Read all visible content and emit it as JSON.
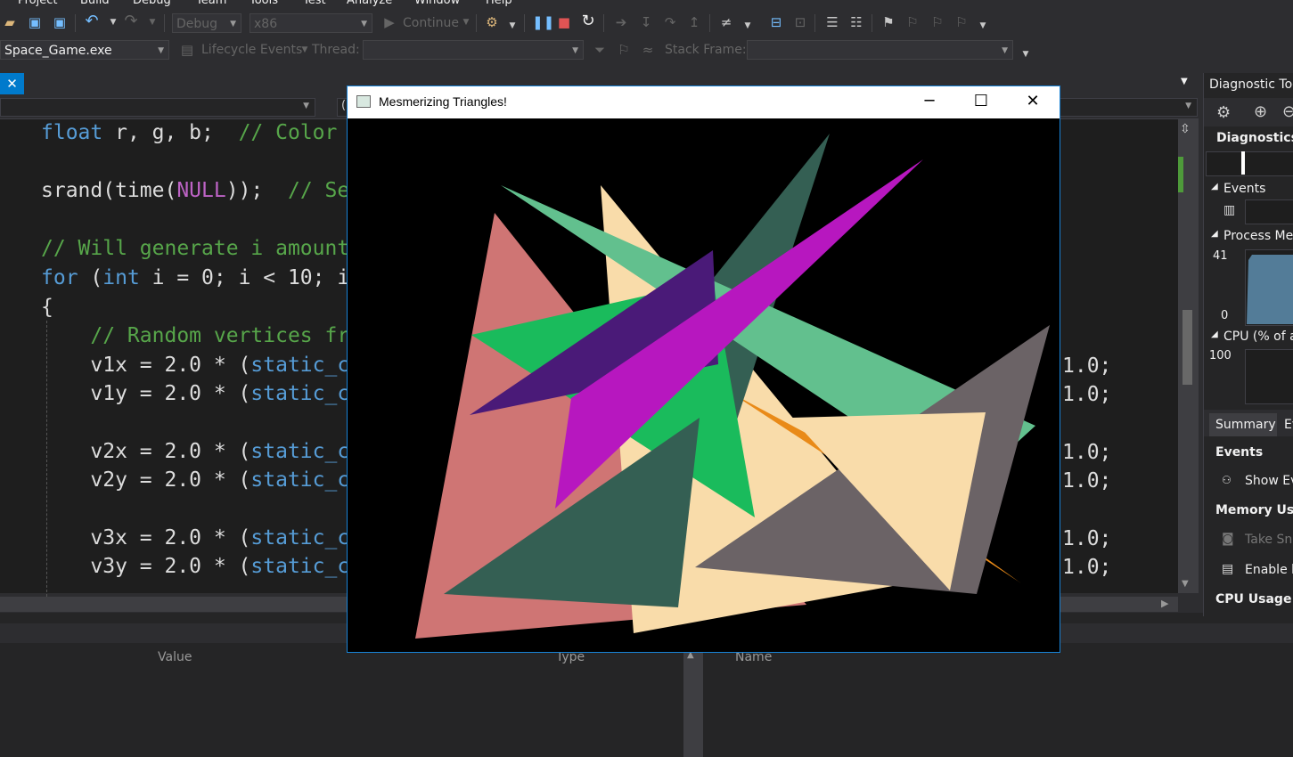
{
  "menu": [
    "Project",
    "Build",
    "Debug",
    "Team",
    "Tools",
    "Test",
    "Analyze",
    "Window",
    "Help"
  ],
  "toolbar": {
    "config": "Debug",
    "platform": "x86",
    "continue_label": "Continue",
    "process": "Space_Game.exe",
    "lifecycle_label": "Lifecycle Events",
    "thread_label": "Thread:",
    "stack_frame_label": "Stack Frame:"
  },
  "editor": {
    "nav_right": "(",
    "lines": [
      {
        "parts": [
          [
            "kw",
            "float"
          ],
          [
            "p",
            " r, g, b;  "
          ],
          [
            "cm",
            "// Color"
          ]
        ]
      },
      {
        "parts": [
          [
            "p",
            "srand(time("
          ],
          [
            "mac",
            "NULL"
          ],
          [
            "p",
            "));  "
          ],
          [
            "cm",
            "// Se"
          ]
        ]
      },
      {
        "parts": [
          [
            "cm",
            "// Will generate i amount"
          ]
        ]
      },
      {
        "parts": [
          [
            "kw",
            "for"
          ],
          [
            "p",
            " ("
          ],
          [
            "kw",
            "int"
          ],
          [
            "p",
            " i = 0; i < 10; i"
          ]
        ]
      },
      {
        "parts": [
          [
            "p",
            "{"
          ]
        ]
      },
      {
        "parts": [
          [
            "cm",
            "    // Random vertices fr"
          ]
        ]
      },
      {
        "parts": [
          [
            "p",
            "    v1x = 2.0 * ("
          ],
          [
            "kw",
            "static_c"
          ]
        ]
      },
      {
        "parts": [
          [
            "p",
            "    v1y = 2.0 * ("
          ],
          [
            "kw",
            "static_c"
          ]
        ]
      },
      {
        "parts": [
          [
            "p",
            "    v2x = 2.0 * ("
          ],
          [
            "kw",
            "static_c"
          ]
        ]
      },
      {
        "parts": [
          [
            "p",
            "    v2y = 2.0 * ("
          ],
          [
            "kw",
            "static_c"
          ]
        ]
      },
      {
        "parts": [
          [
            "p",
            "    v3x = 2.0 * ("
          ],
          [
            "kw",
            "static_c"
          ]
        ]
      },
      {
        "parts": [
          [
            "p",
            "    v3y = 2.0 * ("
          ],
          [
            "kw",
            "static_c"
          ]
        ]
      }
    ],
    "right_fragment": "1.0;"
  },
  "bottom_panel": {
    "col_value": "Value",
    "col_type": "Type",
    "col_name": "Name"
  },
  "diagnostics": {
    "title": "Diagnostic Too",
    "session": "Diagnostics s",
    "events": "Events",
    "process_memory": "Process Me",
    "mem_max": "41",
    "mem_min": "0",
    "cpu": "CPU (% of a",
    "cpu_max": "100",
    "tab_summary": "Summary",
    "tab_events": "Ev",
    "sec_events": "Events",
    "show_events": "Show Ev",
    "sec_memory": "Memory Usag",
    "take_snapshot": "Take Sna",
    "enable_heap": "Enable h",
    "sec_cpu": "CPU Usage"
  },
  "app_window": {
    "title": "Mesmerizing Triangles!",
    "minimize": "─",
    "maximize": "☐",
    "close": "✕",
    "triangle_colors": [
      "#cf7574",
      "#f9dcaa",
      "#e98a18",
      "#345f53",
      "#62c08e",
      "#1abb5c",
      "#6b6366",
      "#4a1a78",
      "#b717bf"
    ]
  }
}
